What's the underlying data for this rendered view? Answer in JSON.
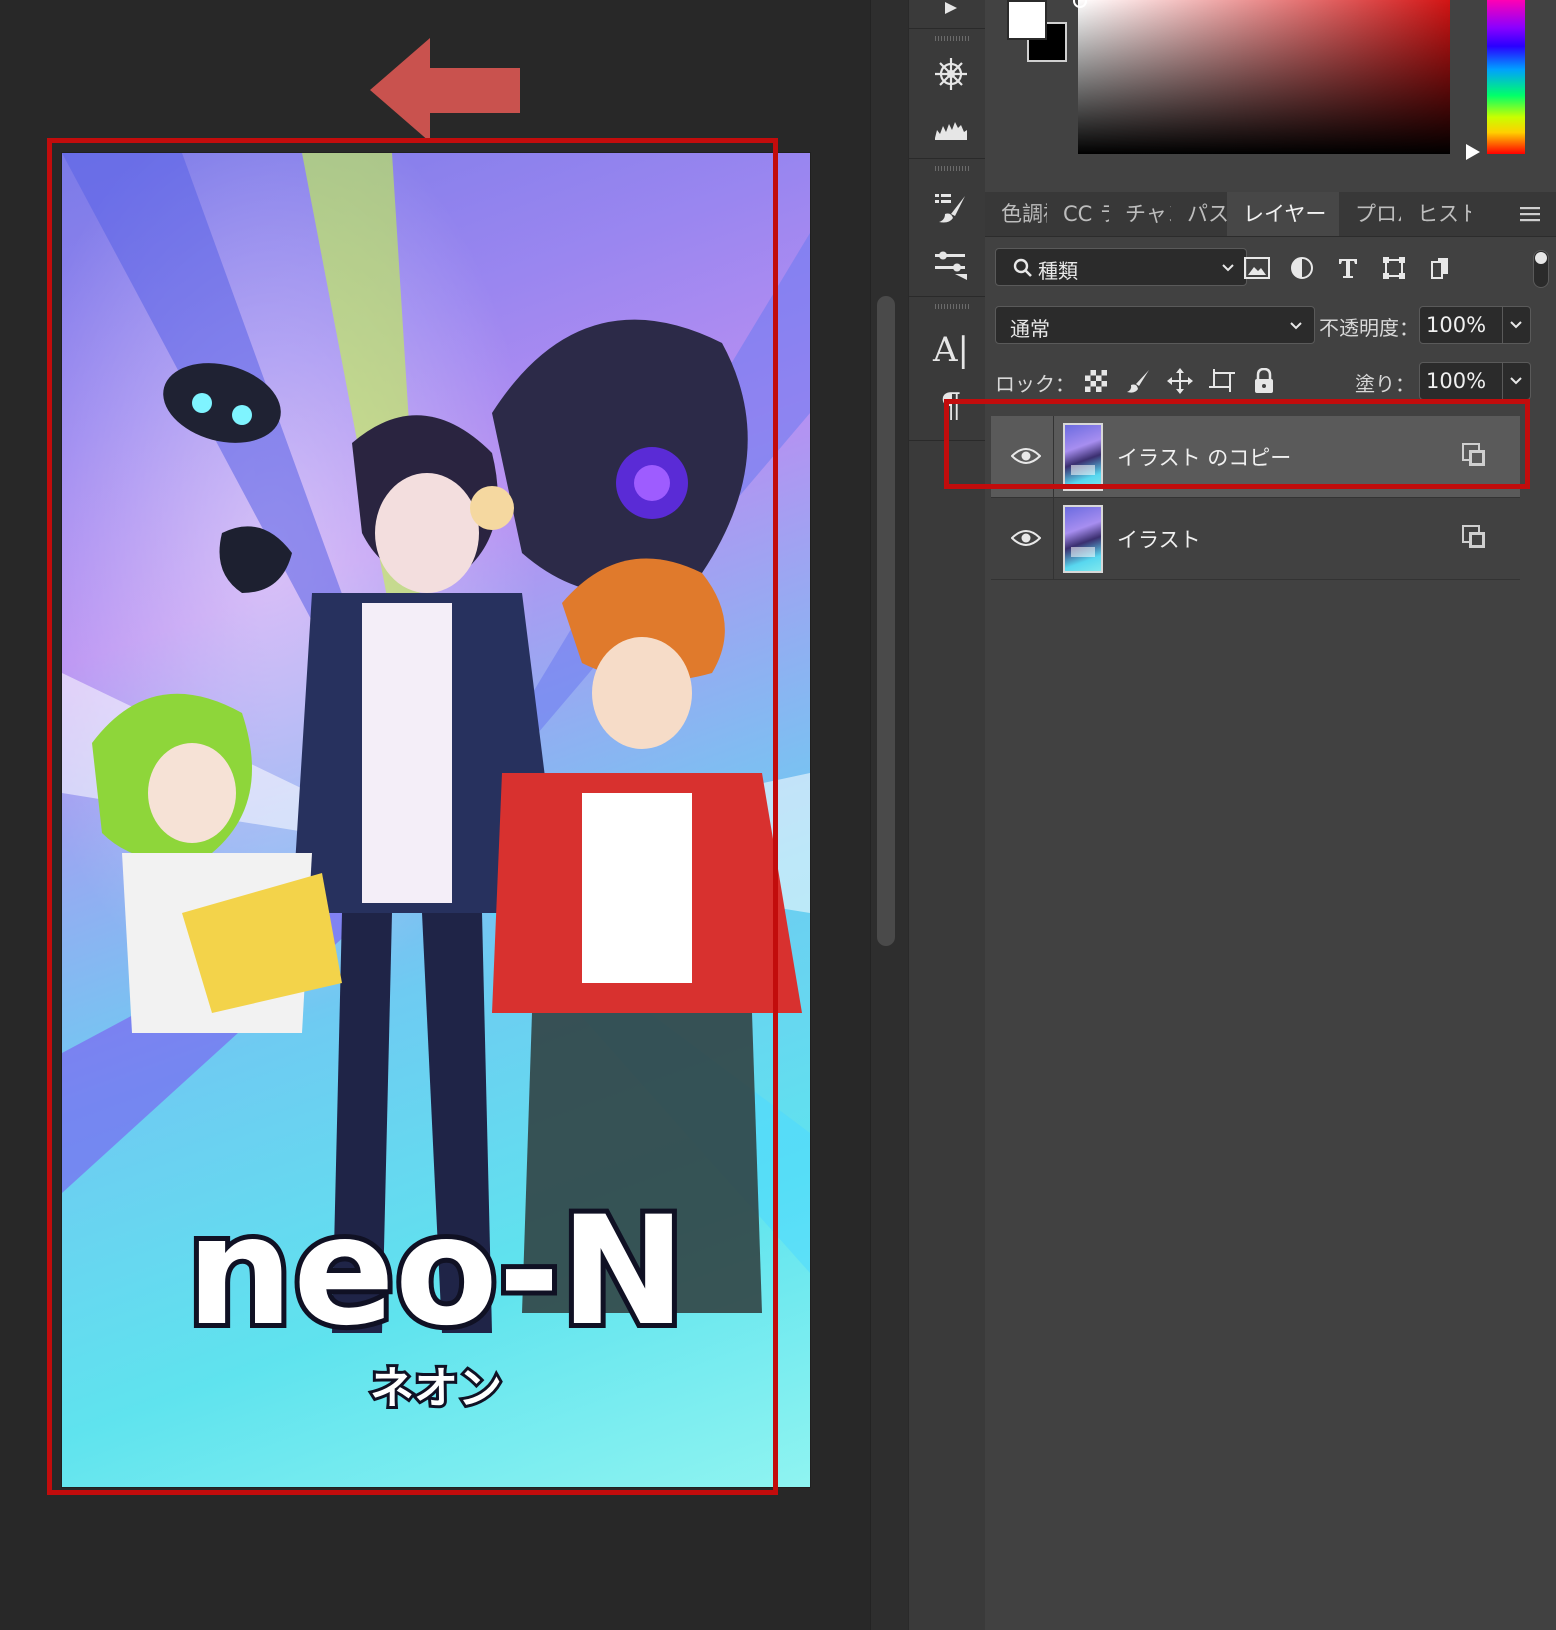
{
  "canvas": {
    "artwork_logo": "neo-N",
    "artwork_subtitle": "ネオン"
  },
  "panel_tabs": [
    {
      "label": "色調補正",
      "active": false
    },
    {
      "label": "CC ライブラリ",
      "active": false
    },
    {
      "label": "チャンネル",
      "active": false
    },
    {
      "label": "パス",
      "active": false
    },
    {
      "label": "レイヤー",
      "active": true
    },
    {
      "label": "プロパティ",
      "active": false
    },
    {
      "label": "ヒストリー",
      "active": false
    }
  ],
  "layers_panel": {
    "filter_label": "種類",
    "blend_mode": "通常",
    "opacity_label": "不透明度：",
    "opacity_value": "100%",
    "lock_label": "ロック：",
    "fill_label": "塗り：",
    "fill_value": "100%",
    "layers": [
      {
        "name": "イラスト のコピー",
        "visible": true,
        "selected": true
      },
      {
        "name": "イラスト",
        "visible": true,
        "selected": false
      }
    ]
  },
  "colors": {
    "foreground": "#ffffff",
    "background": "#000000",
    "highlight": "#c20c0c",
    "arrow": "#c9524e"
  }
}
